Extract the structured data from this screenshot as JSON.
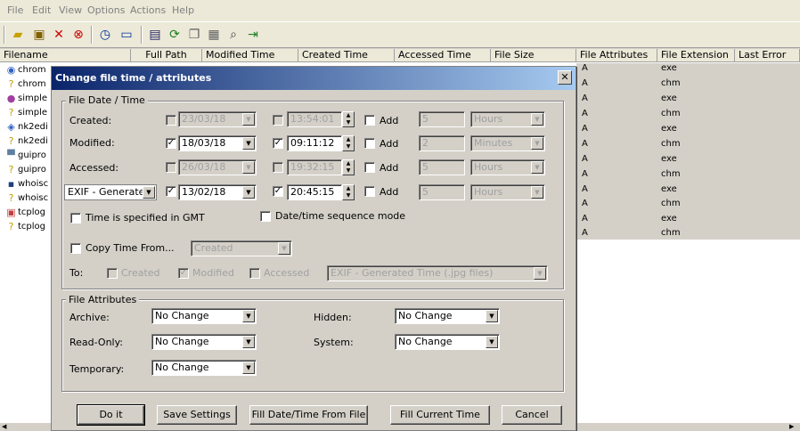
{
  "menu": [
    "File",
    "Edit",
    "View",
    "Options",
    "Actions",
    "Help"
  ],
  "toolbar_icons": [
    "open-folder-icon",
    "properties-icon",
    "delete-icon",
    "stop-icon",
    "clock-icon",
    "window-icon",
    "save-icon",
    "refresh-icon",
    "copy-icon",
    "properties-page-icon",
    "find-icon",
    "exit-icon"
  ],
  "columns": [
    "Filename",
    "Full Path",
    "Modified Time",
    "Created Time",
    "Accessed Time",
    "File Size",
    "File Attributes",
    "File Extension",
    "Last Error"
  ],
  "rows": [
    {
      "name": "chrom",
      "attr": "A",
      "ext": "exe"
    },
    {
      "name": "chrom",
      "attr": "A",
      "ext": "chm"
    },
    {
      "name": "simple",
      "attr": "A",
      "ext": "exe"
    },
    {
      "name": "simple",
      "attr": "A",
      "ext": "chm"
    },
    {
      "name": "nk2edi",
      "attr": "A",
      "ext": "exe"
    },
    {
      "name": "nk2edi",
      "attr": "A",
      "ext": "chm"
    },
    {
      "name": "guipro",
      "attr": "A",
      "ext": "exe"
    },
    {
      "name": "guipro",
      "attr": "A",
      "ext": "chm"
    },
    {
      "name": "whoisc",
      "attr": "A",
      "ext": "exe"
    },
    {
      "name": "whoisc",
      "attr": "A",
      "ext": "chm"
    },
    {
      "name": "tcplog",
      "attr": "A",
      "ext": "exe"
    },
    {
      "name": "tcplog",
      "attr": "A",
      "ext": "chm"
    }
  ],
  "dialog": {
    "title": "Change file time / attributes",
    "close": "✕",
    "date_group": "File Date / Time",
    "created_label": "Created:",
    "modified_label": "Modified:",
    "accessed_label": "Accessed:",
    "exif_combo": "EXIF - Generated",
    "created": {
      "date": "23/03/18",
      "time": "13:54:01",
      "add_value": "5",
      "unit": "Hours"
    },
    "modified": {
      "date": "18/03/18",
      "time": "09:11:12",
      "add_value": "2",
      "unit": "Minutes"
    },
    "accessed": {
      "date": "26/03/18",
      "time": "19:32:15",
      "add_value": "5",
      "unit": "Hours"
    },
    "exif": {
      "date": "13/02/18",
      "time": "20:45:15",
      "add_value": "5",
      "unit": "Hours"
    },
    "add_label": "Add",
    "gmt_label": "Time is specified in GMT",
    "sequence_label": "Date/time sequence mode",
    "copy_time_label": "Copy Time From...",
    "copy_time_source": "Created",
    "to_label": "To:",
    "to_created": "Created",
    "to_modified": "Modified",
    "to_accessed": "Accessed",
    "to_exif": "EXIF - Generated Time (.jpg files)",
    "attr_group": "File Attributes",
    "archive_label": "Archive:",
    "archive_value": "No Change",
    "hidden_label": "Hidden:",
    "hidden_value": "No Change",
    "readonly_label": "Read-Only:",
    "readonly_value": "No Change",
    "system_label": "System:",
    "system_value": "No Change",
    "temporary_label": "Temporary:",
    "temporary_value": "No Change",
    "btn_doit": "Do it",
    "btn_save": "Save Settings",
    "btn_fill_file": "Fill Date/Time From File",
    "btn_fill_current": "Fill Current Time",
    "btn_cancel": "Cancel"
  }
}
